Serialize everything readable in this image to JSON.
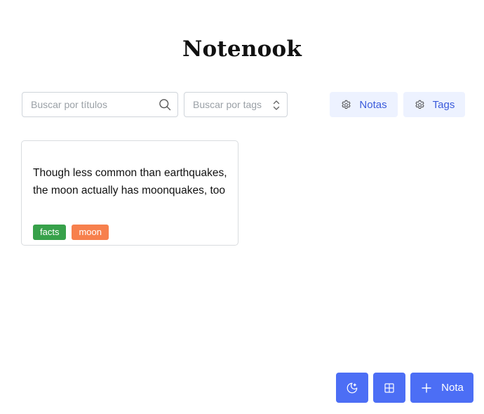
{
  "app": {
    "title": "Notenook"
  },
  "filters": {
    "title_search_placeholder": "Buscar por títulos",
    "tag_search_placeholder": "Buscar por tags"
  },
  "settings": {
    "notes_label": "Notas",
    "tags_label": "Tags"
  },
  "notes": [
    {
      "text": "Though less common than earthquakes, the moon actually has moonquakes, too",
      "tags": [
        {
          "label": "facts",
          "color": "#37a14a"
        },
        {
          "label": "moon",
          "color": "#f7804d"
        }
      ]
    }
  ],
  "actions": {
    "add_note_label": "Nota"
  },
  "icons": {
    "search": "search-icon",
    "select_chevrons": "chevron-up-down-icon",
    "settings": "gear-icon",
    "theme": "moon-stars-icon",
    "layout": "grid-icon",
    "add": "plus-icon"
  },
  "colors": {
    "accent": "#4c6ef5",
    "accent_light": "#edf2ff",
    "accent_text": "#3b5bdb"
  }
}
